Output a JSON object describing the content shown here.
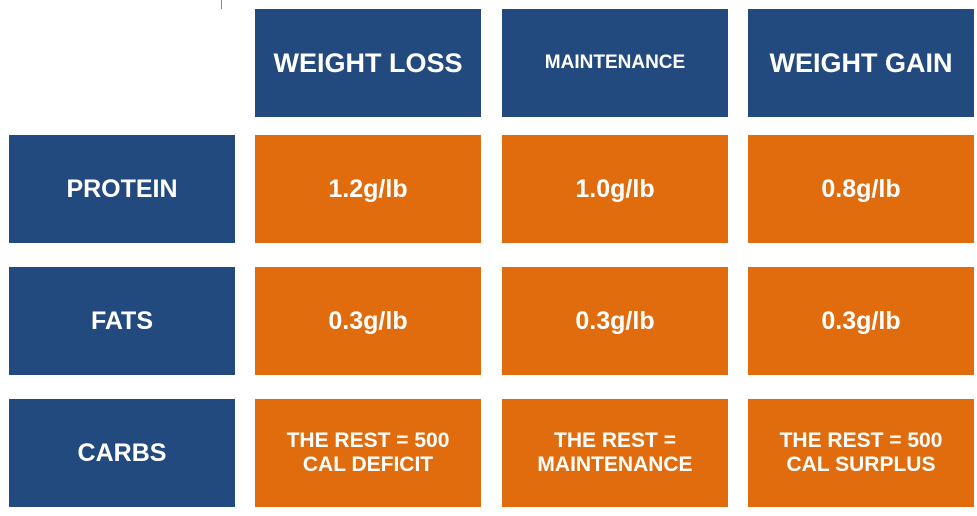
{
  "columns": [
    {
      "label": "WEIGHT LOSS"
    },
    {
      "label": "MAINTENANCE"
    },
    {
      "label": "WEIGHT GAIN"
    }
  ],
  "rows": [
    {
      "label": "PROTEIN",
      "values": [
        "1.2g/lb",
        "1.0g/lb",
        "0.8g/lb"
      ]
    },
    {
      "label": "FATS",
      "values": [
        "0.3g/lb",
        "0.3g/lb",
        "0.3g/lb"
      ]
    },
    {
      "label": "CARBS",
      "values": [
        "THE  REST = 500\nCAL DEFICIT",
        "THE REST =\nMAINTENANCE",
        "THE REST = 500\nCAL SURPLUS"
      ]
    }
  ],
  "colors": {
    "header_blue": "#234a7e",
    "value_orange": "#e06c0d",
    "text": "#ffffff"
  }
}
